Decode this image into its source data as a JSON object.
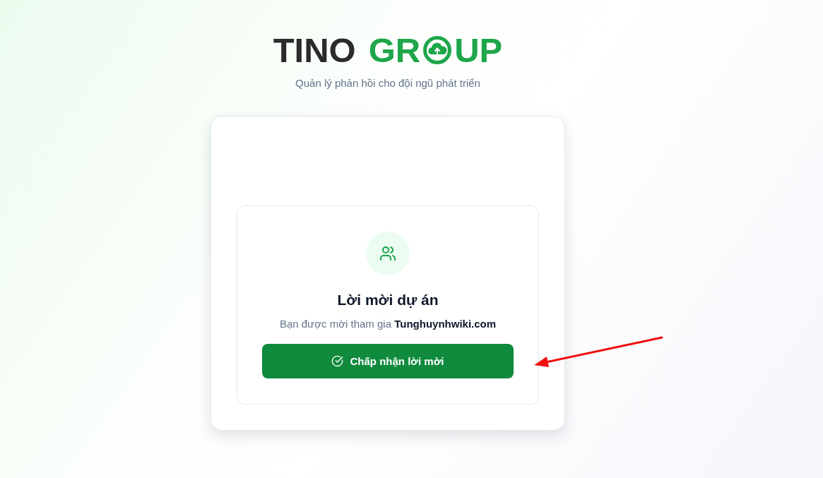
{
  "header": {
    "logo": {
      "dark_text": "TINO",
      "green_text_start": "GR",
      "green_text_end": "UP"
    },
    "tagline": "Quản lý phản hồi cho đội ngũ phát triển"
  },
  "invitation": {
    "title": "Lời mời dự án",
    "message": "Bạn được mời tham gia **Tunghuynhwiki.com**",
    "accept_button": "Chấp nhận lời mời"
  }
}
